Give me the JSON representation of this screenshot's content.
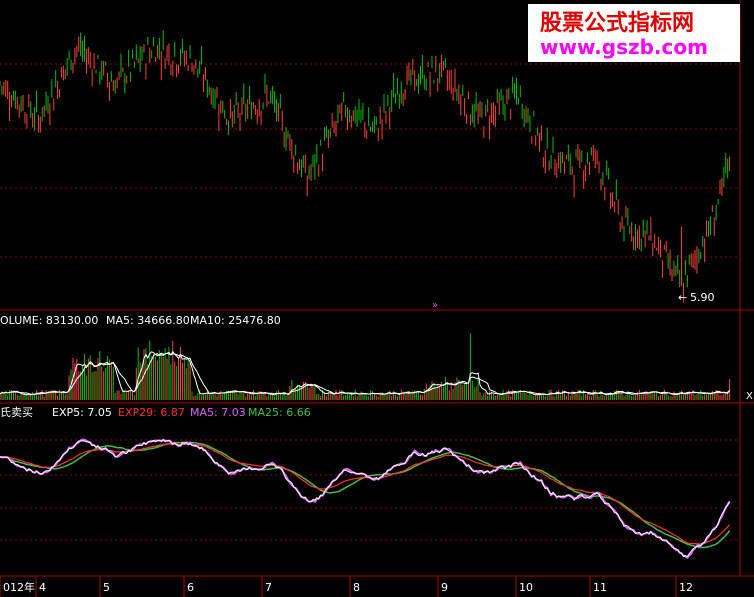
{
  "watermark": {
    "title": "股票公式指标网",
    "url": "www.gszb.com"
  },
  "price_panel": {
    "low_label": "5.90",
    "low_arrow": "←"
  },
  "volume_panel": {
    "label_volume": "OLUME: 83130.00",
    "label_ma5": "MA5: 34666.80",
    "label_ma10": "MA10: 25476.80"
  },
  "indicator_panel": {
    "name": "氏卖买",
    "exp5": "EXP5: 7.05",
    "exp29": "EXP29: 6.87",
    "ma5": "MA5: 7.03",
    "ma25": "MA25: 6.66"
  },
  "x_axis": {
    "labels": [
      "012年",
      "4",
      "5",
      "6",
      "7",
      "8",
      "9",
      "10",
      "11",
      "12"
    ]
  },
  "colors": {
    "background": "#000000",
    "grid": "#8b0000",
    "up": "#ff4040",
    "down": "#00c000",
    "white": "#ffffff",
    "red_line": "#ff3030",
    "magenta_line": "#e060ff",
    "green_line": "#40c040",
    "watermark_text": "#e00000",
    "watermark_url": "#ff00ff",
    "watermark_bg": "#ffffff"
  },
  "chart_data": [
    {
      "type": "candlestick",
      "title": "",
      "trend_points_index": [
        0,
        20,
        40,
        60,
        80,
        100,
        120,
        140,
        160,
        170,
        180,
        195,
        210,
        230,
        250,
        270,
        285,
        300,
        310,
        325,
        340,
        355,
        370,
        380
      ],
      "trend_points_price": [
        7.6,
        7.3,
        7.9,
        7.6,
        7.9,
        7.8,
        7.3,
        7.5,
        6.8,
        7.1,
        7.4,
        7.2,
        7.6,
        7.7,
        7.3,
        7.5,
        7.0,
        6.9,
        7.0,
        6.4,
        6.3,
        5.9,
        6.4,
        6.9
      ],
      "lowest_value": 5.9,
      "ylim": [
        5.7,
        8.3
      ]
    },
    {
      "type": "bar",
      "title": "VOLUME",
      "current_volume": 83130.0,
      "ma5": 34666.8,
      "ma10": 25476.8
    },
    {
      "type": "line",
      "title": "氏卖买",
      "series": [
        {
          "name": "EXP5",
          "last": 7.05
        },
        {
          "name": "EXP29",
          "last": 6.87
        },
        {
          "name": "MA5",
          "last": 7.03
        },
        {
          "name": "MA25",
          "last": 6.66
        }
      ]
    }
  ]
}
